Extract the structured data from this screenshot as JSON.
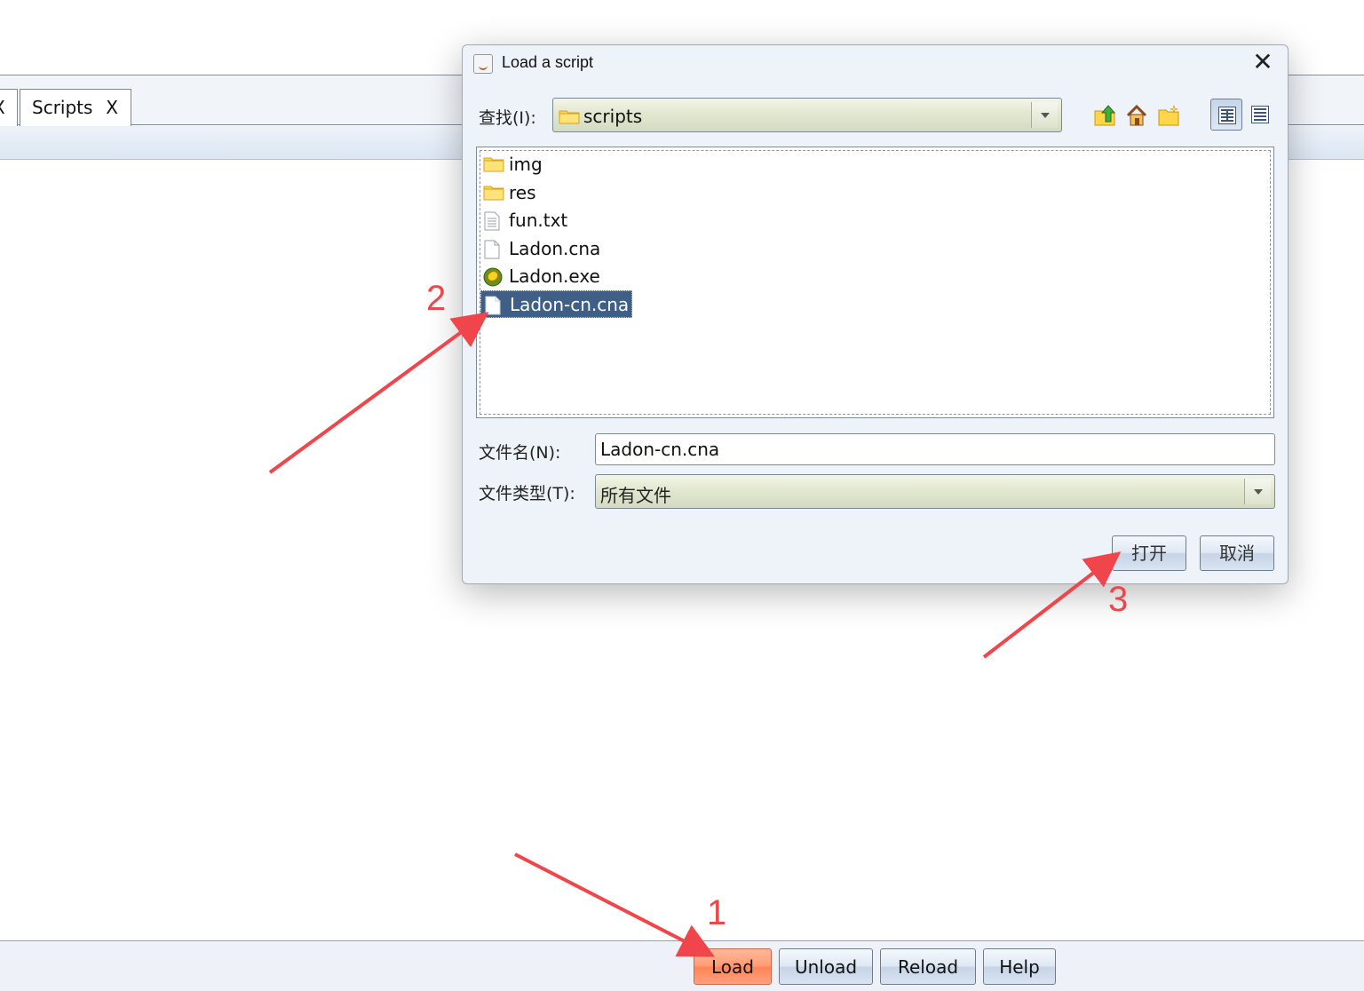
{
  "app": {
    "tab_partial_label": "X",
    "tab_scripts_label": "Scripts",
    "tab_scripts_close": "X",
    "bottom_buttons": {
      "load": "Load",
      "unload": "Unload",
      "reload": "Reload",
      "help": "Help"
    }
  },
  "dialog": {
    "title": "Load a script",
    "close_glyph": "✕",
    "look_in_label": "查找(I):",
    "look_in_value": "scripts",
    "files": [
      {
        "name": "img",
        "icon": "folder-icon"
      },
      {
        "name": "res",
        "icon": "folder-icon"
      },
      {
        "name": "fun.txt",
        "icon": "text-file-icon"
      },
      {
        "name": "Ladon.cna",
        "icon": "file-icon"
      },
      {
        "name": "Ladon.exe",
        "icon": "exe-icon"
      },
      {
        "name": "Ladon-cn.cna",
        "icon": "file-icon",
        "selected": true
      }
    ],
    "file_name_label": "文件名(N):",
    "file_name_value": "Ladon-cn.cna",
    "file_type_label": "文件类型(T):",
    "file_type_value": "所有文件",
    "open_button": "打开",
    "cancel_button": "取消"
  },
  "annotations": {
    "step1": "1",
    "step2": "2",
    "step3": "3",
    "color": "#f0454a"
  }
}
